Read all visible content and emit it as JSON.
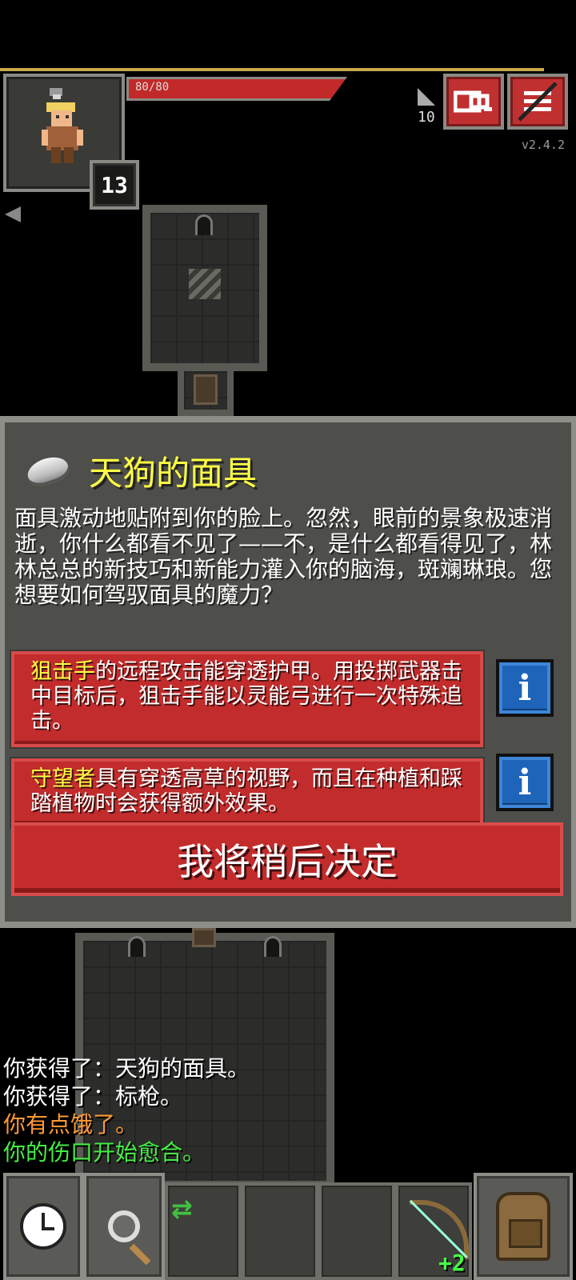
{
  "hud": {
    "hp_text": "80/80",
    "hp_fraction": 1.0,
    "level": "13",
    "depth": "10",
    "version": "v2.4.2",
    "journal_icon": "journal-icon",
    "menu_icon": "menu-icon"
  },
  "dialog": {
    "title": "天狗的面具",
    "icon": "mask-icon",
    "description": "面具激动地贴附到你的脸上。忽然，眼前的景象极速消逝，你什么都看不见了——不，是什么都看得见了，林林总总的新技巧和新能力灌入你的脑海，斑斓琳琅。您想要如何驾驭面具的魔力？",
    "choices": [
      {
        "name": "狙击手",
        "text": "的远程攻击能穿透护甲。用投掷武器击中目标后，狙击手能以灵能弓进行一次特殊追击。",
        "info": "i"
      },
      {
        "name": "守望者",
        "text": "具有穿透高草的视野，而且在种植和踩踏植物时会获得额外效果。",
        "info": "i"
      }
    ],
    "decide_label": "我将稍后决定"
  },
  "log": [
    {
      "text": "你获得了：天狗的面具。",
      "color": "#ffffff"
    },
    {
      "text": "你获得了：标枪。",
      "color": "#ffffff"
    },
    {
      "text": "你有点饿了。",
      "color": "#ff9933"
    },
    {
      "text": "你的伤口开始愈合。",
      "color": "#44ee44"
    }
  ],
  "toolbar": {
    "wait_icon": "clock-icon",
    "search_icon": "magnifier-icon",
    "swap_icon": "swap-icon",
    "quickslot_item_level": "+2",
    "inventory_icon": "backpack-icon"
  },
  "colors": {
    "highlight": "#ffff44",
    "button_red": "#c22c2c",
    "info_blue": "#1e64b8",
    "panel": "#4e4e4a"
  }
}
